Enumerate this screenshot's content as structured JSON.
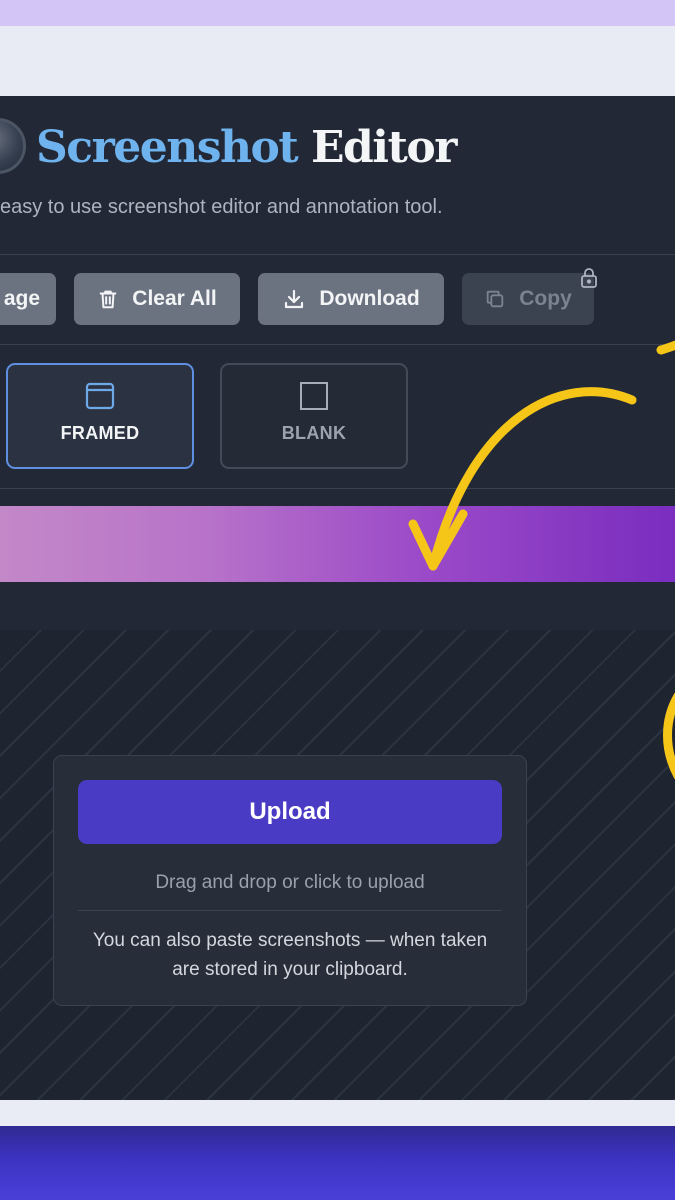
{
  "app": {
    "title_accent": "Screenshot",
    "title_rest": "Editor",
    "subtitle": "easy to use screenshot editor and annotation tool."
  },
  "toolbar": {
    "image_label": "age",
    "clear_label": "Clear All",
    "download_label": "Download",
    "copy_label": "Copy"
  },
  "modes": {
    "framed_label": "FRAMED",
    "blank_label": "BLANK",
    "selected": "FRAMED"
  },
  "upload": {
    "button_label": "Upload",
    "drag_text": "Drag and drop or click to upload",
    "paste_line1": "You can also paste screenshots — when taken",
    "paste_line2": "are stored in your clipboard."
  },
  "colors": {
    "title_accent": "#6fb3ee",
    "app_bg": "#222835",
    "upload_button": "#4a3bc4",
    "selected_border": "#5f8fe0",
    "annotation_arrow": "#f5c518"
  }
}
